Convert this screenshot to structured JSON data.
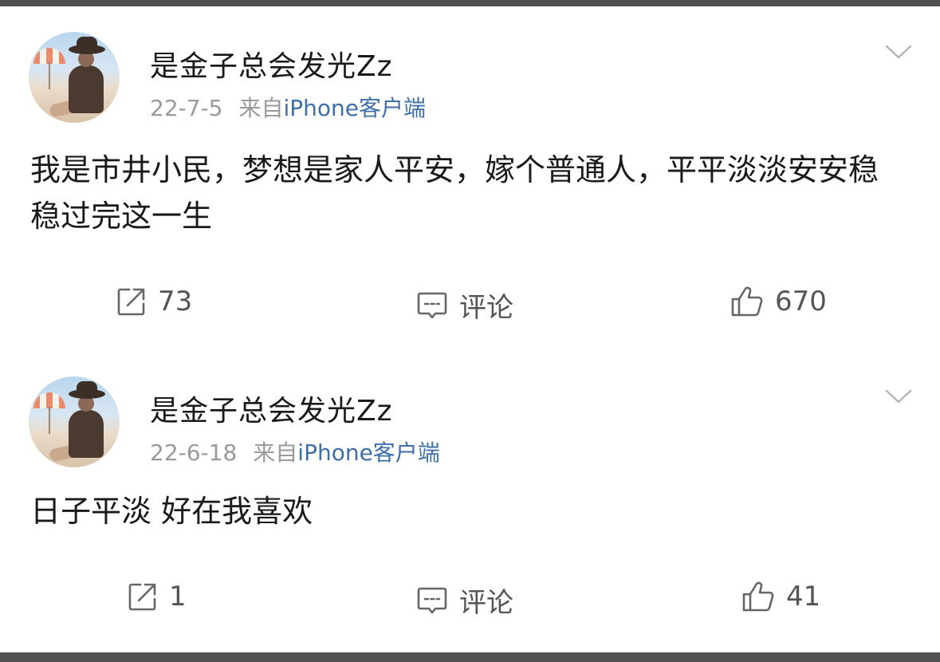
{
  "posts": [
    {
      "username": "是金子总会发光Zz",
      "date": "22-7-5",
      "source_prefix": "来自",
      "device": "iPhone客户端",
      "content": "我是市井小民，梦想是家人平安，嫁个普通人，平平淡淡安安稳稳过完这一生",
      "repost_count": "73",
      "comment_label": "评论",
      "like_count": "670"
    },
    {
      "username": "是金子总会发光Zz",
      "date": "22-6-18",
      "source_prefix": "来自",
      "device": "iPhone客户端",
      "content": "日子平淡 好在我喜欢",
      "repost_count": "1",
      "comment_label": "评论",
      "like_count": "41"
    }
  ],
  "icons": {
    "repost": "share-icon",
    "comment": "comment-icon",
    "like": "thumbs-up-icon",
    "more": "chevron-down-icon"
  },
  "colors": {
    "device_link": "#3f6fa8",
    "meta_gray": "#9a9a9a",
    "action_gray": "#555555",
    "frame_bar": "#505050"
  }
}
